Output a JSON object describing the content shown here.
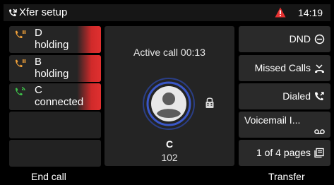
{
  "topbar": {
    "title": "Xfer setup",
    "title_icon": "phone-transfer-icon",
    "warning_icon": "warning-icon",
    "time": "14:19"
  },
  "lines": [
    {
      "name": "D",
      "state": "holding",
      "icon": "phone-hold-icon",
      "icon_color": "#f2a23a",
      "highlight": "#d02a2a"
    },
    {
      "name": "B",
      "state": "holding",
      "icon": "phone-hold-icon",
      "icon_color": "#f2a23a",
      "highlight": "#d02a2a"
    },
    {
      "name": "C",
      "state": "connected",
      "icon": "phone-connected-icon",
      "icon_color": "#3ec44a",
      "highlight": "#d02a2a"
    }
  ],
  "call": {
    "status": "Active call 00:13",
    "caller_name": "C",
    "caller_number": "102",
    "avatar_icon": "contact-avatar-icon",
    "lock_icon": "encrypted-lock-icon"
  },
  "side_buttons": [
    {
      "label": "DND",
      "icon": "do-not-disturb-icon"
    },
    {
      "label": "Missed Calls",
      "icon": "missed-calls-icon"
    },
    {
      "label": "Dialed",
      "icon": "dialed-calls-icon"
    },
    {
      "label": "Voicemail I...",
      "icon": "voicemail-icon"
    },
    {
      "label": "1 of 4 pages",
      "icon": "pages-icon"
    }
  ],
  "softkeys": {
    "left": "End call",
    "right": "Transfer"
  },
  "colors": {
    "accent_red": "#d02a2a",
    "hold_orange": "#f2a23a",
    "connected_green": "#3ec44a",
    "avatar_ring": "#3a57c8"
  }
}
